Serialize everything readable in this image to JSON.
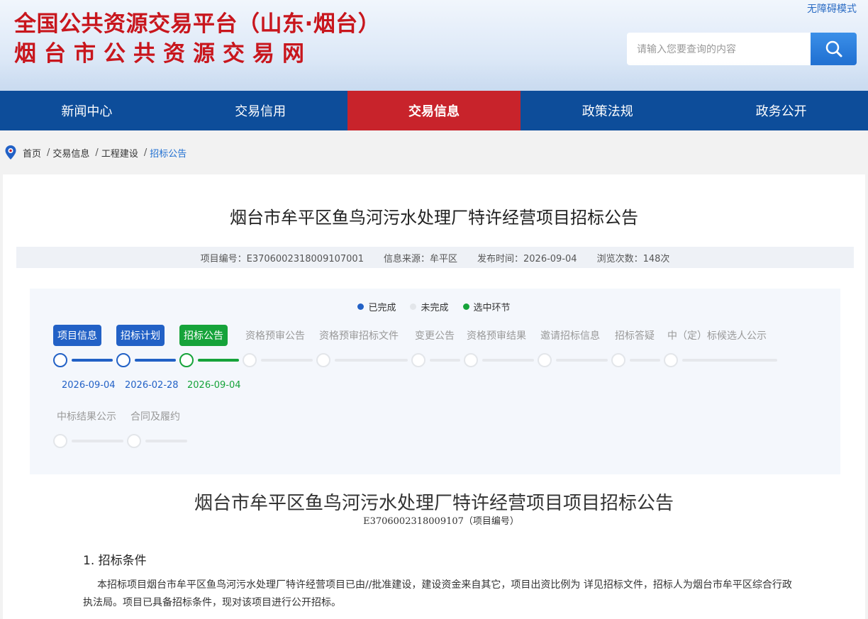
{
  "header": {
    "title_line1": "全国公共资源交易平台（山东·烟台）",
    "title_line2": "烟台市公共资源交易网",
    "accessibility_link": "无障碍模式",
    "search_placeholder": "请输入您要查询的内容",
    "search_icon": "search-icon"
  },
  "nav": {
    "items": [
      {
        "label": "新闻中心"
      },
      {
        "label": "交易信用"
      },
      {
        "label": "交易信息",
        "active": true
      },
      {
        "label": "政策法规"
      },
      {
        "label": "政务公开"
      }
    ]
  },
  "breadcrumb": {
    "items": [
      "首页",
      "交易信息",
      "工程建设",
      "招标公告"
    ],
    "separator": "/"
  },
  "article": {
    "title": "烟台市牟平区鱼鸟河污水处理厂特许经营项目招标公告",
    "meta": {
      "project_no": "项目编号：E3706002318009107001",
      "source": "信息来源：牟平区",
      "publish_time": "发布时间：2026-09-04",
      "views": "浏览次数：148次"
    }
  },
  "process": {
    "legend": [
      {
        "label": "已完成",
        "color": "#2261c6"
      },
      {
        "label": "未完成",
        "color": "#e3e6ea"
      },
      {
        "label": "选中环节",
        "color": "#16a33a"
      }
    ],
    "steps": [
      {
        "label": "项目信息",
        "status": "done",
        "date": "2026-09-04"
      },
      {
        "label": "招标计划",
        "status": "done",
        "date": "2026-02-28"
      },
      {
        "label": "招标公告",
        "status": "selected",
        "date": "2026-09-04"
      },
      {
        "label": "资格预审公告",
        "status": "pending"
      },
      {
        "label": "资格预审招标文件",
        "status": "pending"
      },
      {
        "label": "变更公告",
        "status": "pending"
      },
      {
        "label": "资格预审结果",
        "status": "pending"
      },
      {
        "label": "邀请招标信息",
        "status": "pending"
      },
      {
        "label": "招标答疑",
        "status": "pending"
      },
      {
        "label": "中（定）标候选人公示",
        "status": "pending"
      },
      {
        "label": "中标结果公示",
        "status": "pending"
      },
      {
        "label": "合同及履约",
        "status": "pending"
      }
    ]
  },
  "document": {
    "title": "烟台市牟平区鱼鸟河污水处理厂特许经营项目项目招标公告",
    "subtitle": "E3706002318009107（项目编号）",
    "section1_heading": "1. 招标条件",
    "section1_body": "本招标项目烟台市牟平区鱼鸟河污水处理厂特许经营项目已由//批准建设，建设资金来自其它，项目出资比例为 详见招标文件，招标人为烟台市牟平区综合行政执法局。项目已具备招标条件，现对该项目进行公开招标。"
  },
  "colors": {
    "brand_red": "#c8161d",
    "nav_blue": "#0d4d9a",
    "nav_active": "#c8232b",
    "done_blue": "#2261c6",
    "selected_green": "#16a33a"
  }
}
